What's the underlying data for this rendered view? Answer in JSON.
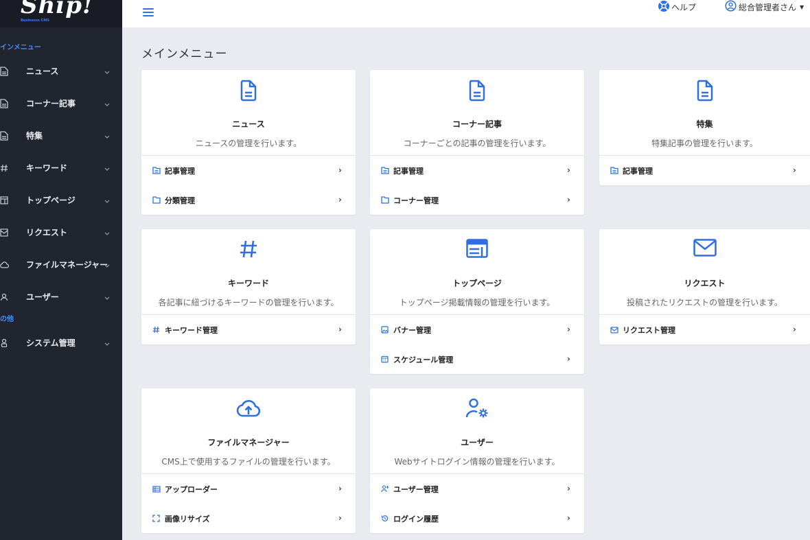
{
  "logo": {
    "text": "Ship!",
    "subtext": "Businesss CMS"
  },
  "sidebar": {
    "section_main": "インメニュー",
    "section_other": "の他",
    "items": [
      {
        "label": "ニュース",
        "icon": "document-icon"
      },
      {
        "label": "コーナー記事",
        "icon": "document-icon"
      },
      {
        "label": "特集",
        "icon": "document-icon"
      },
      {
        "label": "キーワード",
        "icon": "hash-icon"
      },
      {
        "label": "トップページ",
        "icon": "layout-icon"
      },
      {
        "label": "リクエスト",
        "icon": "mail-icon"
      },
      {
        "label": "ファイルマネージャー",
        "icon": "cloud-icon"
      },
      {
        "label": "ユーザー",
        "icon": "user-icon"
      },
      {
        "label": "システム管理",
        "icon": "settings-icon"
      }
    ]
  },
  "header": {
    "help_label": "ヘルプ",
    "user_label": "総合管理者さん"
  },
  "main": {
    "title": "メインメニュー",
    "cards": [
      {
        "title": "ニュース",
        "desc": "ニュースの管理を行います。",
        "links": [
          {
            "label": "記事管理",
            "icon": "list-icon"
          },
          {
            "label": "分類管理",
            "icon": "folder-icon"
          }
        ]
      },
      {
        "title": "コーナー記事",
        "desc": "コーナーごとの記事の管理を行います。",
        "links": [
          {
            "label": "記事管理",
            "icon": "list-icon"
          },
          {
            "label": "コーナー管理",
            "icon": "folder-icon"
          }
        ]
      },
      {
        "title": "特集",
        "desc": "特集記事の管理を行います。",
        "links": [
          {
            "label": "記事管理",
            "icon": "list-icon"
          }
        ]
      },
      {
        "title": "キーワード",
        "desc": "各記事に紐づけるキーワードの管理を行います。",
        "links": [
          {
            "label": "キーワード管理",
            "icon": "hash-icon"
          }
        ]
      },
      {
        "title": "トップページ",
        "desc": "トップページ掲載情報の管理を行います。",
        "links": [
          {
            "label": "バナー管理",
            "icon": "image-icon"
          },
          {
            "label": "スケジュール管理",
            "icon": "calendar-icon"
          }
        ]
      },
      {
        "title": "リクエスト",
        "desc": "投稿されたリクエストの管理を行います。",
        "links": [
          {
            "label": "リクエスト管理",
            "icon": "mail-icon"
          }
        ]
      },
      {
        "title": "ファイルマネージャー",
        "desc": "CMS上で使用するファイルの管理を行います。",
        "links": [
          {
            "label": "アップローダー",
            "icon": "list-icon"
          },
          {
            "label": "画像リサイズ",
            "icon": "resize-icon"
          }
        ]
      },
      {
        "title": "ユーザー",
        "desc": "Webサイトログイン情報の管理を行います。",
        "links": [
          {
            "label": "ユーザー管理",
            "icon": "user-plus-icon"
          },
          {
            "label": "ログイン履歴",
            "icon": "history-icon"
          }
        ]
      }
    ]
  },
  "colors": {
    "accent": "#2f6fe0",
    "sidebar_bg": "#21252f",
    "page_bg": "#e9ebf0"
  }
}
